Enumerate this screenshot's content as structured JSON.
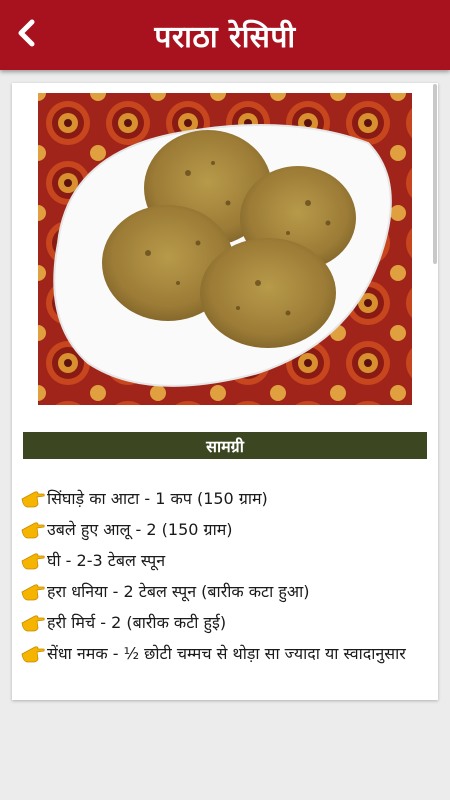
{
  "app_bar": {
    "title": "पराठा रेसिपी",
    "back_icon": "chevron-left-icon",
    "color": "#a8121e"
  },
  "recipe": {
    "section_title": "सामग्री",
    "section_color": "#3c4722",
    "bullet_icon": "pointing-hand-icon",
    "ingredients": [
      "सिंघाड़े का आटा - 1 कप (150 ग्राम)",
      "उबले हुए आलू - 2 (150 ग्राम)",
      "घी - 2-3 टेबल स्पून",
      "हरा धनिया - 2 टेबल स्पून (बारीक कटा हुआ)",
      "हरी मिर्च - 2 (बारीक कटी हुई)",
      "सेंधा नमक - ½ छोटी चम्मच से थोड़ा सा ज्यादा या स्वादानुसार"
    ]
  }
}
